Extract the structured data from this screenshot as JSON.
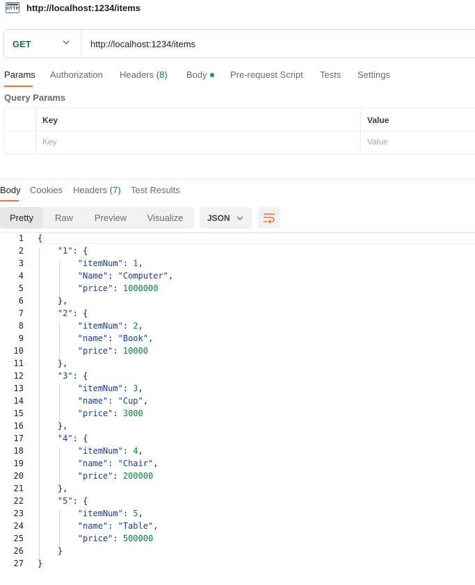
{
  "title_bar": {
    "icon": "http-icon",
    "icon_text": "HTTP",
    "url": "http://localhost:1234/items"
  },
  "request": {
    "method": "GET",
    "url": "http://localhost:1234/items",
    "tabs": [
      {
        "label": "Params",
        "count": "",
        "active": true
      },
      {
        "label": "Authorization",
        "count": "",
        "active": false
      },
      {
        "label": "Headers",
        "count": "(8)",
        "active": false
      },
      {
        "label": "Body",
        "count": "",
        "active": false
      },
      {
        "label": "Pre-request Script",
        "count": "",
        "active": false
      },
      {
        "label": "Tests",
        "count": "",
        "active": false
      },
      {
        "label": "Settings",
        "count": "",
        "active": false
      }
    ],
    "query_params_label": "Query Params",
    "params_table": {
      "headers": [
        "Key",
        "Value"
      ],
      "placeholders": [
        "Key",
        "Value"
      ]
    }
  },
  "response": {
    "tabs": [
      {
        "label": "Body",
        "count": "",
        "active": true
      },
      {
        "label": "Cookies",
        "count": "",
        "active": false
      },
      {
        "label": "Headers",
        "count": "(7)",
        "active": false
      },
      {
        "label": "Test Results",
        "count": "",
        "active": false
      }
    ],
    "view_modes": [
      "Pretty",
      "Raw",
      "Preview",
      "Visualize"
    ],
    "active_view": "Pretty",
    "format": "JSON",
    "wrap_icon": "wrap-lines-icon",
    "lines": [
      "{",
      "    \"1\": {",
      "        \"itemNum\": 1,",
      "        \"Name\": \"Computer\",",
      "        \"price\": 1000000",
      "    },",
      "    \"2\": {",
      "        \"itemNum\": 2,",
      "        \"name\": \"Book\",",
      "        \"price\": 10000",
      "    },",
      "    \"3\": {",
      "        \"itemNum\": 3,",
      "        \"name\": \"Cup\",",
      "        \"price\": 3000",
      "    },",
      "    \"4\": {",
      "        \"itemNum\": 4,",
      "        \"name\": \"Chair\",",
      "        \"price\": 200000",
      "    },",
      "    \"5\": {",
      "        \"itemNum\": 5,",
      "        \"name\": \"Table\",",
      "        \"price\": 500000",
      "    }",
      "}"
    ]
  },
  "colors": {
    "accent": "#ff6c37",
    "method_get": "#0a7d3e",
    "json_key": "#1e3a8a",
    "json_number": "#0a7d3e"
  }
}
